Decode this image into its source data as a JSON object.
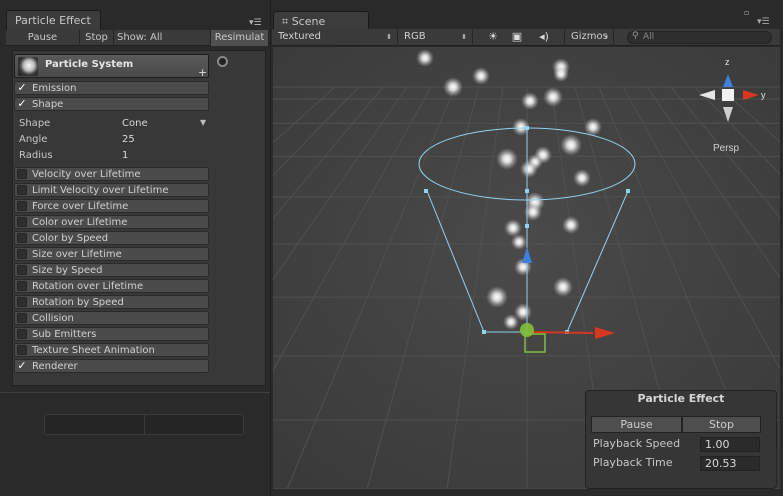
{
  "left_panel": {
    "tab_title": "Particle Effect",
    "toolbar": {
      "pause": "Pause",
      "stop": "Stop",
      "show": "Show: All",
      "resimulate": "Resimulat"
    },
    "system_title": "Particle System",
    "modules": [
      {
        "label": "Emission",
        "checked": true
      },
      {
        "label": "Shape",
        "checked": true
      },
      {
        "label": "Velocity over Lifetime",
        "checked": false
      },
      {
        "label": "Limit Velocity over Lifetime",
        "checked": false
      },
      {
        "label": "Force over Lifetime",
        "checked": false
      },
      {
        "label": "Color over Lifetime",
        "checked": false
      },
      {
        "label": "Color by Speed",
        "checked": false
      },
      {
        "label": "Size over Lifetime",
        "checked": false
      },
      {
        "label": "Size by Speed",
        "checked": false
      },
      {
        "label": "Rotation over Lifetime",
        "checked": false
      },
      {
        "label": "Rotation by Speed",
        "checked": false
      },
      {
        "label": "Collision",
        "checked": false
      },
      {
        "label": "Sub Emitters",
        "checked": false
      },
      {
        "label": "Texture Sheet Animation",
        "checked": false
      },
      {
        "label": "Renderer",
        "checked": true
      }
    ],
    "shape_props": {
      "shape_label": "Shape",
      "shape_value": "Cone",
      "angle_label": "Angle",
      "angle_value": "25",
      "radius_label": "Radius",
      "radius_value": "1"
    }
  },
  "scene": {
    "tab_title": "Scene",
    "toolbar": {
      "render_mode": "Textured",
      "color_mode": "RGB",
      "gizmos": "Gizmos",
      "search_placeholder": "All"
    },
    "projection_label": "Persp",
    "gizmo_axes": {
      "y": "y",
      "z": "z"
    }
  },
  "overlay": {
    "title": "Particle Effect",
    "pause": "Pause",
    "stop": "Stop",
    "playback_speed_label": "Playback Speed",
    "playback_speed_value": "1.00",
    "playback_time_label": "Playback Time",
    "playback_time_value": "20.53"
  },
  "colors": {
    "x_axis": "#d8361f",
    "y_axis": "#7fc13b",
    "z_axis": "#3e7fe0",
    "emitter_outline": "#8fd3ee"
  }
}
